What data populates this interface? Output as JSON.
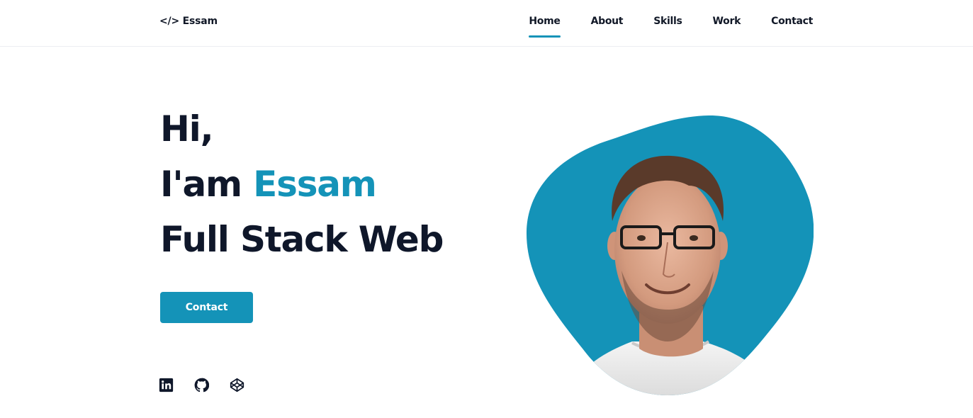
{
  "brand": {
    "logo_glyph": "</>",
    "name": "Essam"
  },
  "nav": {
    "items": [
      {
        "label": "Home",
        "active": true
      },
      {
        "label": "About",
        "active": false
      },
      {
        "label": "Skills",
        "active": false
      },
      {
        "label": "Work",
        "active": false
      },
      {
        "label": "Contact",
        "active": false
      }
    ]
  },
  "hero": {
    "greeting": "Hi,",
    "intro_prefix": "I'am",
    "name": "Essam",
    "role": "Full Stack Web",
    "cta_label": "Contact"
  },
  "socials": [
    {
      "icon": "linkedin-icon"
    },
    {
      "icon": "github-icon"
    },
    {
      "icon": "codepen-icon"
    }
  ],
  "colors": {
    "accent": "#1493b8",
    "text": "#0f172a",
    "background": "#ffffff"
  }
}
